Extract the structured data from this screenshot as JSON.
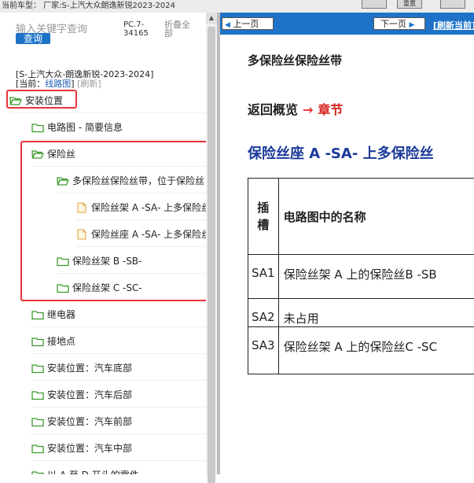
{
  "top_bar": {
    "car_info": "当前车型： 厂家:S-上汽大众朗逸新锐2023-2024",
    "btn1": "",
    "btn2": "重置",
    "btn3": ""
  },
  "left": {
    "search_placeholder": "输入关键字查询",
    "search_button": "查询",
    "pc_text": "PC.7-34165",
    "fold_all": "折叠全部",
    "car_line": "[S-上汽大众-朗逸新锐-2023-2024]",
    "current_label": "[当前：",
    "current_link": "线路图",
    "current_close": "]",
    "refresh": "[刷新]"
  },
  "tree": [
    {
      "label": "安装位置",
      "icon": "folder-open"
    },
    {
      "label": "电路图 - 简要信息",
      "icon": "folder"
    },
    {
      "label": "保险丝",
      "icon": "folder-open"
    },
    {
      "label": "多保险丝保险丝带，位于保险丝",
      "icon": "folder-open"
    },
    {
      "label": "保险丝架 A -SA- 上多保险丝",
      "icon": "document"
    },
    {
      "label": "保险丝座 A -SA- 上多保险丝",
      "icon": "document"
    },
    {
      "label": "保险丝架 B -SB-",
      "icon": "folder"
    },
    {
      "label": "保险丝架 C -SC-",
      "icon": "folder"
    },
    {
      "label": "继电器",
      "icon": "folder"
    },
    {
      "label": "接地点",
      "icon": "folder"
    },
    {
      "label": "安装位置：汽车底部",
      "icon": "folder"
    },
    {
      "label": "安装位置：汽车后部",
      "icon": "folder"
    },
    {
      "label": "安装位置：汽车前部",
      "icon": "folder"
    },
    {
      "label": "安装位置：汽车中部",
      "icon": "folder"
    },
    {
      "label": "以 A 至 D 开头的零件",
      "icon": "folder"
    }
  ],
  "right": {
    "prev_page": "上一页",
    "next_page": "下一页",
    "refresh_current": "[刷新当前]",
    "doc_title": "多保险丝保险丝带",
    "back_overview": "返回概览",
    "arrow": "→",
    "chapter": "章节",
    "section_title": "保险丝座 A -SA- 上多保险丝",
    "table": {
      "header_slot": "插槽",
      "header_name": "电路图中的名称",
      "rows": [
        {
          "slot": "SA1",
          "name": "保险丝架 A 上的保险丝B -SB"
        },
        {
          "slot": "SA2",
          "name": "未占用"
        },
        {
          "slot": "SA3",
          "name": "保险丝架 A 上的保险丝C -SC"
        }
      ]
    }
  },
  "colors": {
    "accent_blue": "#1e73c8",
    "highlight_red": "#e8343a",
    "folder_green": "#3c9a2c",
    "title_blue": "#1b3a9a"
  }
}
